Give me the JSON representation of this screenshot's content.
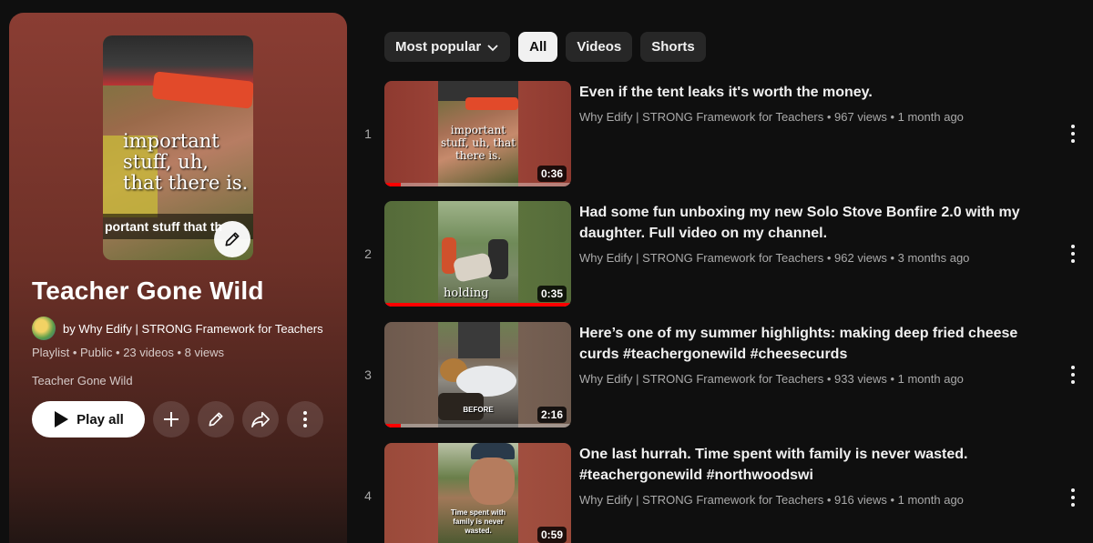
{
  "playlist": {
    "title": "Teacher Gone Wild",
    "owner": "by Why Edify | STRONG Framework for Teachers",
    "type": "Playlist",
    "visibility": "Public",
    "video_count": "23 videos",
    "views": "8 views",
    "description": "Teacher Gone Wild",
    "cover_text": "important stuff, uh, that there is.",
    "cover_caption": "portant stuff that th",
    "play_all_label": "Play all"
  },
  "filters": {
    "sort_label": "Most popular",
    "chips": [
      "All",
      "Videos",
      "Shorts"
    ],
    "active": "All"
  },
  "videos": [
    {
      "index": "1",
      "title": "Even if the tent leaks it's worth the money.",
      "channel": "Why Edify | STRONG Framework for Teachers",
      "views": "967 views",
      "age": "1 month ago",
      "duration": "0:36",
      "thumb_text": "important stuff, uh, that there is.",
      "progress": 0.09
    },
    {
      "index": "2",
      "title": "Had some fun unboxing my new Solo Stove Bonfire 2.0 with my daughter. Full video on my channel.",
      "channel": "Why Edify | STRONG Framework for Teachers",
      "views": "962 views",
      "age": "3 months ago",
      "duration": "0:35",
      "thumb_text": "holding",
      "progress": 1.0
    },
    {
      "index": "3",
      "title": "Here’s one of my summer highlights: making deep fried cheese curds #teachergonewild #cheesecurds",
      "channel": "Why Edify | STRONG Framework for Teachers",
      "views": "933 views",
      "age": "1 month ago",
      "duration": "2:16",
      "thumb_text": "BEFORE",
      "progress": 0.09
    },
    {
      "index": "4",
      "title": "One last hurrah. Time spent with family is never wasted. #teachergonewild #northwoodswi",
      "channel": "Why Edify | STRONG Framework for Teachers",
      "views": "916 views",
      "age": "1 month ago",
      "duration": "0:59",
      "thumb_text": "Time spent with family is never wasted.",
      "progress": 0
    }
  ],
  "colors": {
    "panel": "#8a3d33",
    "accent_red": "#ff0000",
    "background": "#0f0f0f"
  }
}
